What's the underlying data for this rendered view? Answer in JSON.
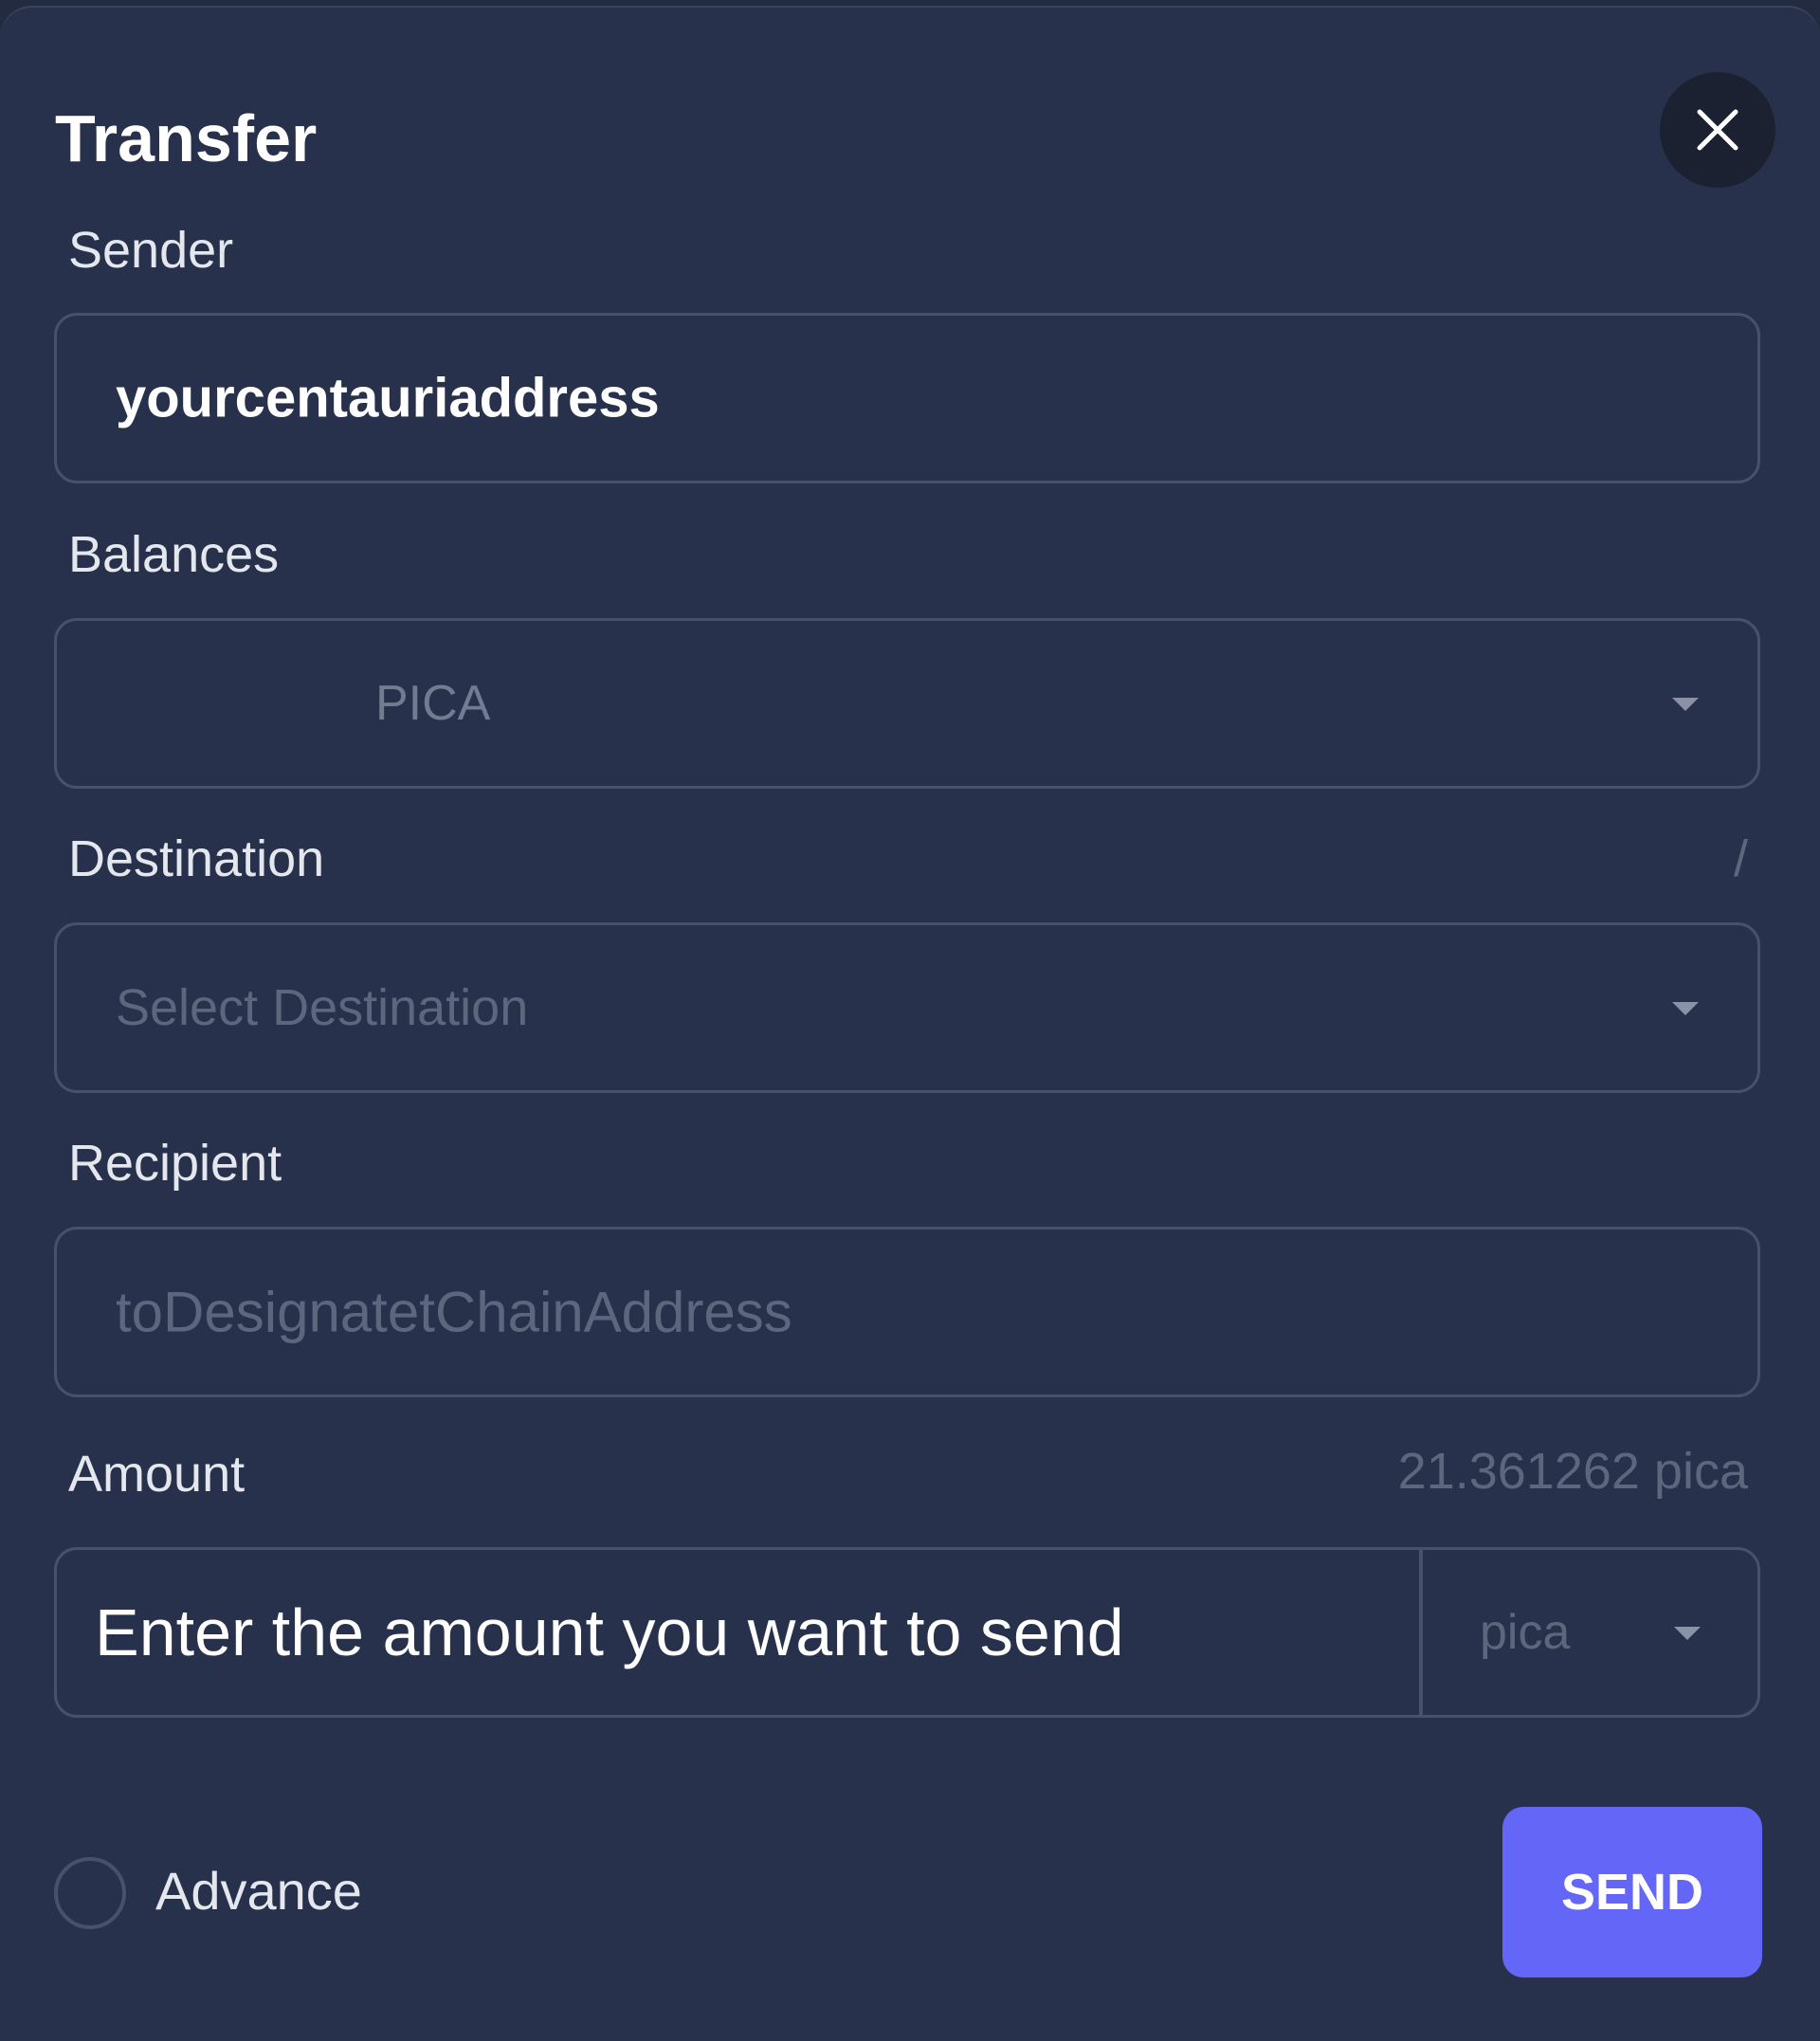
{
  "dialog": {
    "title": "Transfer"
  },
  "sender": {
    "label": "Sender",
    "value": "yourcentauriaddress"
  },
  "balances": {
    "label": "Balances",
    "selected": "PICA"
  },
  "destination": {
    "label": "Destination",
    "note": "/",
    "placeholder": "Select Destination"
  },
  "recipient": {
    "label": "Recipient",
    "placeholder": "toDesignatetChainAddress"
  },
  "amount": {
    "label": "Amount",
    "balance": "21.361262 pica",
    "placeholder": "Enter the amount you want to send",
    "unit": "pica"
  },
  "advance": {
    "label": "Advance"
  },
  "actions": {
    "send_label": "SEND"
  },
  "colors": {
    "background": "#28314b",
    "accent": "#6466f8",
    "border": "#485169"
  },
  "icons": {
    "close": "close-icon",
    "dropdown": "chevron-down-icon"
  }
}
